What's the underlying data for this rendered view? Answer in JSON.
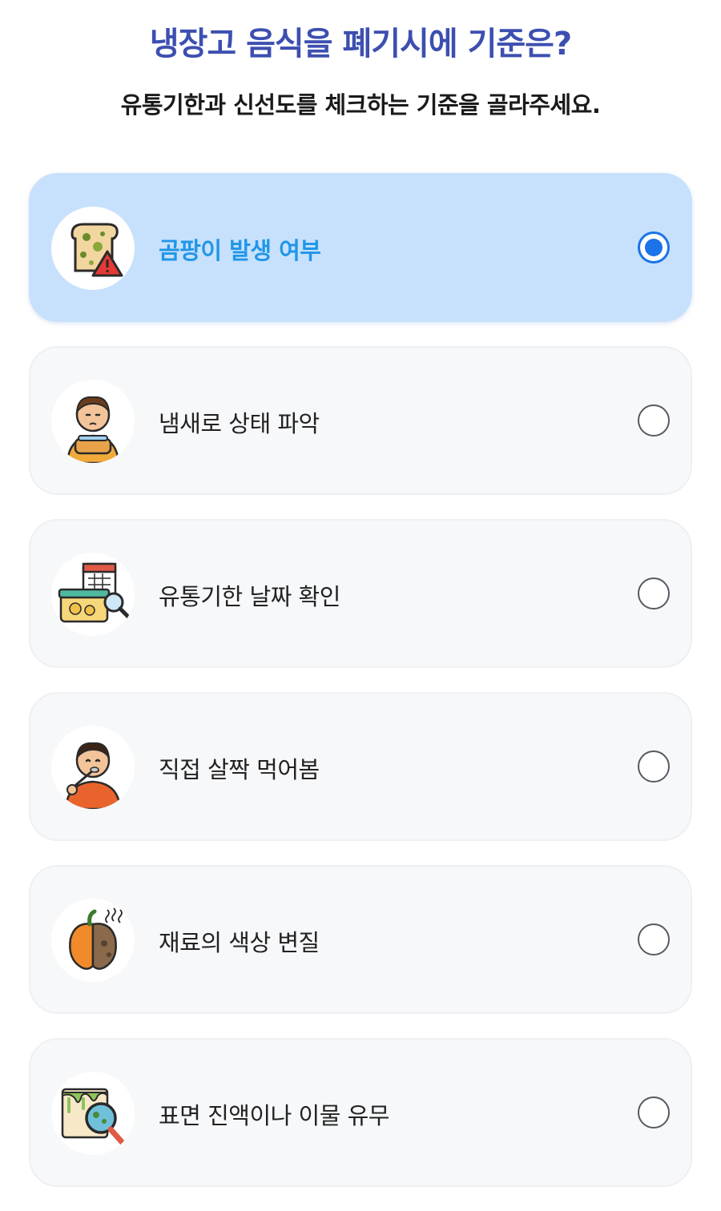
{
  "header": {
    "title": "냉장고 음식을 폐기시에 기준은?",
    "subtitle": "유통기한과 신선도를 체크하는 기준을 골라주세요."
  },
  "options": [
    {
      "label": "곰팡이 발생 여부",
      "icon": "moldy-bread-warning-icon",
      "selected": true
    },
    {
      "label": "냄새로 상태 파악",
      "icon": "person-smelling-food-icon",
      "selected": false
    },
    {
      "label": "유통기한 날짜 확인",
      "icon": "calendar-container-magnifier-icon",
      "selected": false
    },
    {
      "label": "직접 살짝 먹어봄",
      "icon": "person-tasting-food-icon",
      "selected": false
    },
    {
      "label": "재료의 색상 변질",
      "icon": "spoiled-pepper-icon",
      "selected": false
    },
    {
      "label": "표면 진액이나 이물 유무",
      "icon": "slimy-surface-magnifier-icon",
      "selected": false
    }
  ],
  "colors": {
    "title": "#3d4fb0",
    "selected_bg": "#c7e1fd",
    "selected_label": "#2196e8",
    "radio_selected": "#1a73e8",
    "card_bg": "#f7f8fa"
  }
}
